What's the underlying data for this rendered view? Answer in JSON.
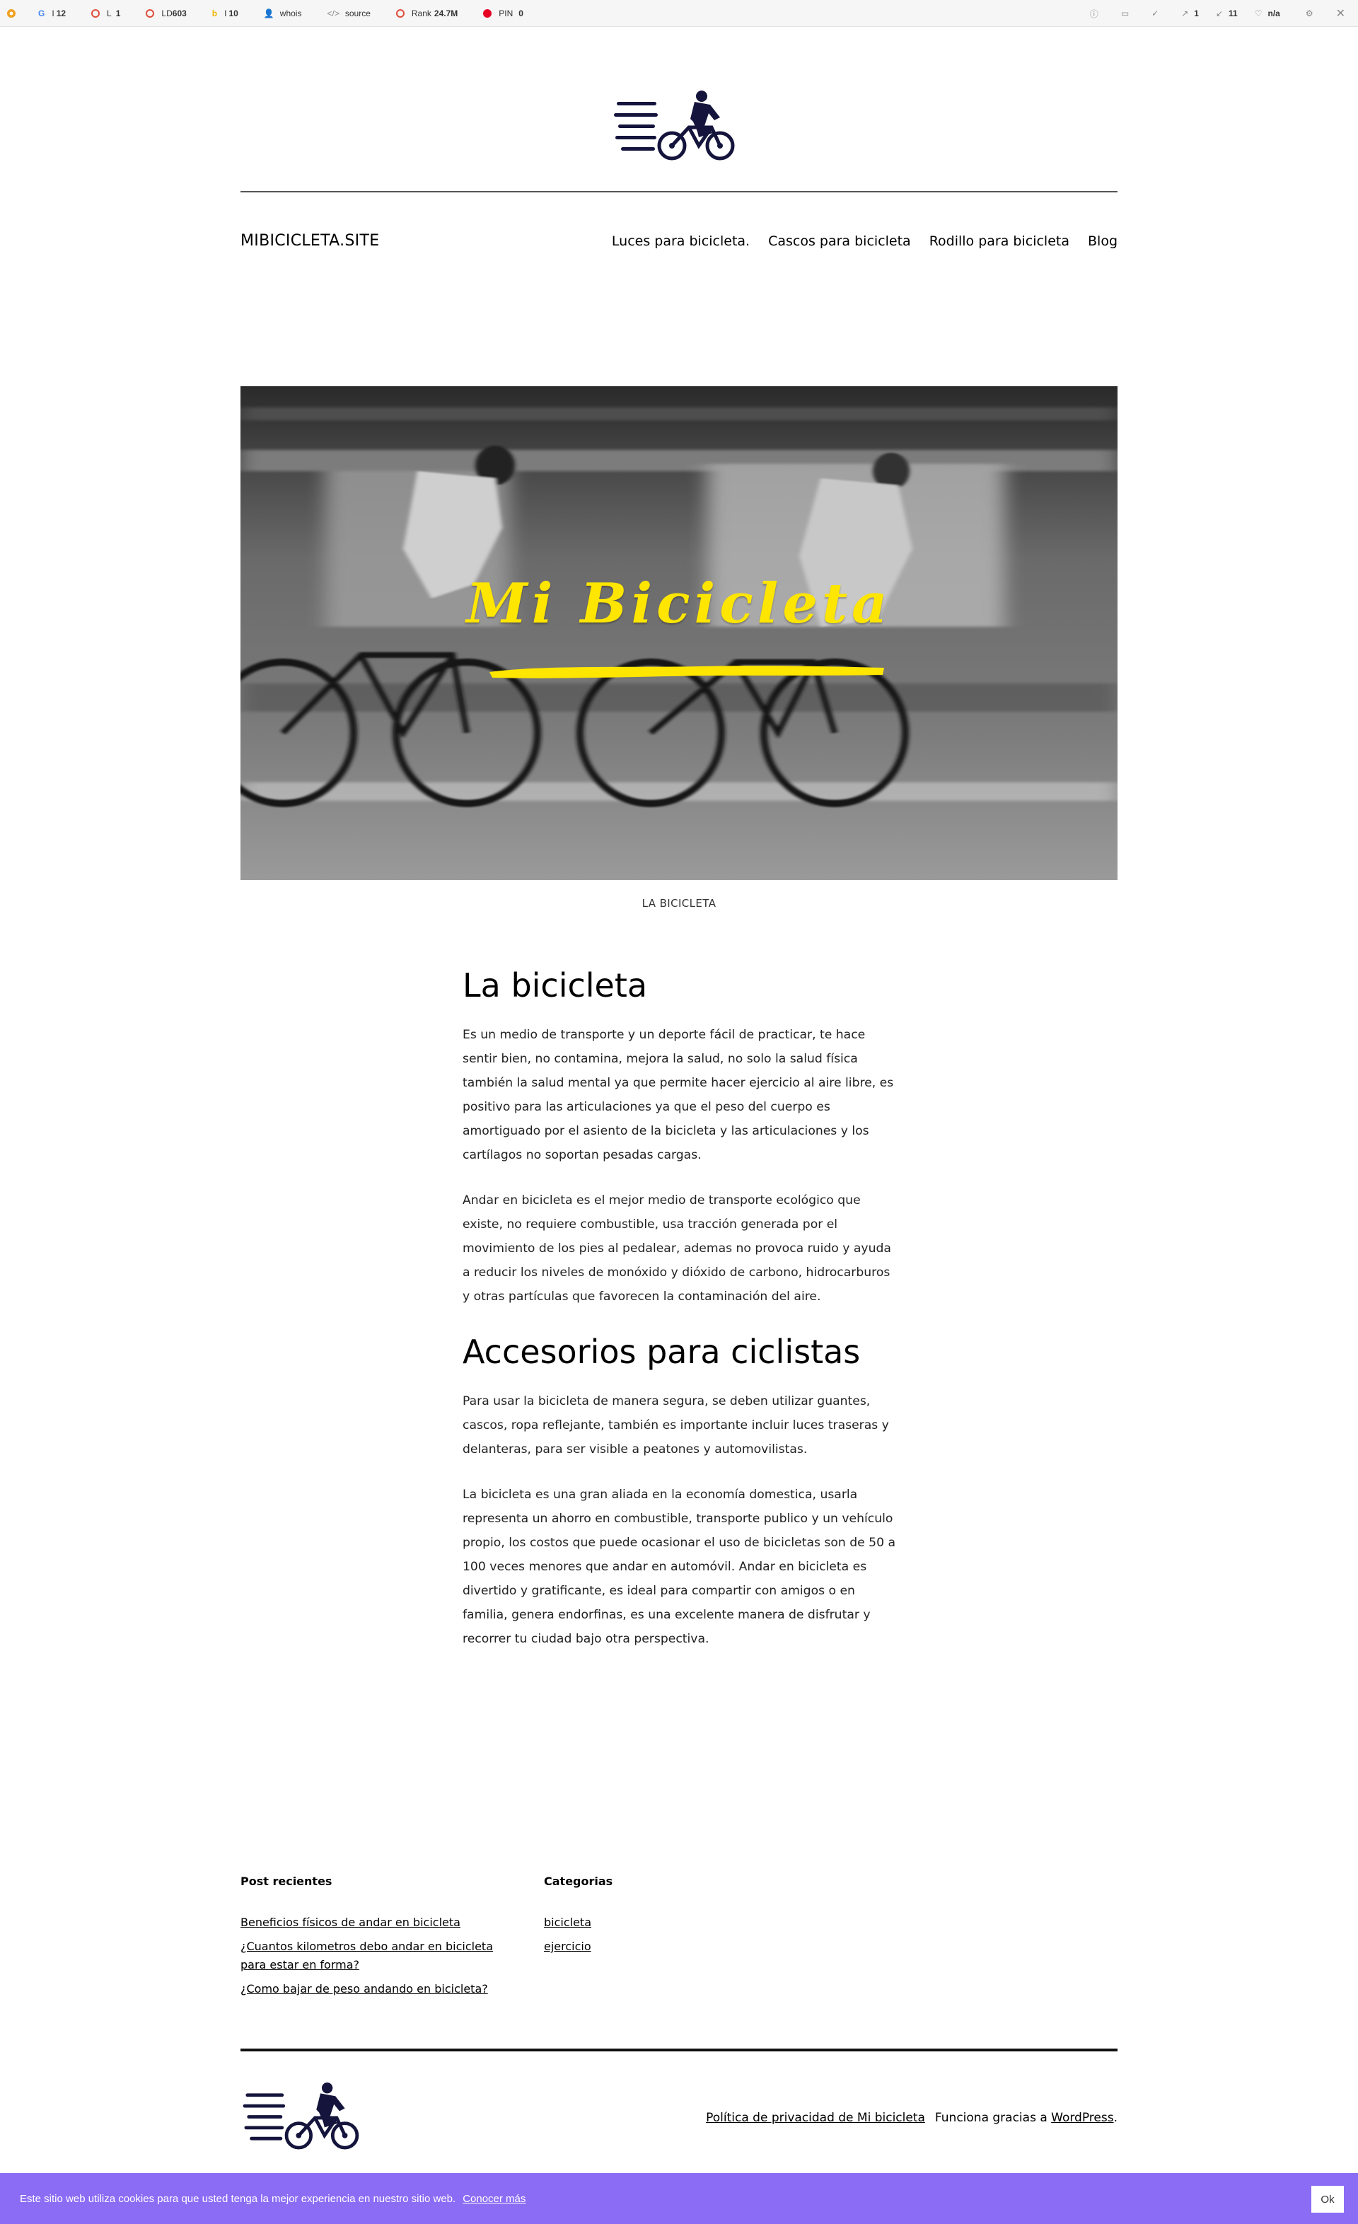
{
  "toolbar": {
    "items": [
      {
        "icon": "google-icon",
        "label": "I",
        "value": "12"
      },
      {
        "icon": "circle-icon",
        "label": "L",
        "value": "1"
      },
      {
        "icon": "circle-icon",
        "label": "LD",
        "value": "603"
      },
      {
        "icon": "bing-icon",
        "label": "I",
        "value": "10"
      },
      {
        "icon": "user-icon",
        "label": "whois",
        "value": ""
      },
      {
        "icon": "code-icon",
        "label": "source",
        "value": ""
      },
      {
        "icon": "circle-icon",
        "label": "Rank",
        "value": "24.7M"
      },
      {
        "icon": "pinterest-icon",
        "label": "PIN",
        "value": "0"
      }
    ],
    "right_items": [
      {
        "icon": "info-icon",
        "value": ""
      },
      {
        "icon": "monitor-icon",
        "value": ""
      },
      {
        "icon": "check-icon",
        "value": ""
      },
      {
        "icon": "external-link-icon",
        "value": "1"
      },
      {
        "icon": "internal-link-icon",
        "value": "11"
      },
      {
        "icon": "bookmark-icon",
        "value": "n/a"
      },
      {
        "icon": "gear-icon",
        "value": ""
      },
      {
        "icon": "close-icon",
        "value": ""
      }
    ]
  },
  "header": {
    "site_title": "MIBICICLETA.SITE",
    "nav": [
      "Luces para bicicleta.",
      "Cascos para bicicleta",
      "Rodillo para bicicleta",
      "Blog"
    ]
  },
  "hero": {
    "title": "Mi Bicicleta",
    "caption": "LA BICICLETA"
  },
  "article": {
    "h1": "La bicicleta",
    "p1": "Es un medio de transporte y un deporte fácil de practicar, te hace sentir bien, no contamina, mejora la salud, no solo la salud física también la salud mental ya que permite hacer ejercicio al aire libre, es positivo para las articulaciones ya que el peso del cuerpo es amortiguado por el asiento de la bicicleta y las articulaciones y los cartílagos no soportan pesadas cargas.",
    "p2": "Andar en bicicleta es el mejor medio de transporte ecológico que existe, no requiere combustible, usa tracción generada por el movimiento de los pies al pedalear, ademas no provoca ruido y ayuda a reducir los niveles de monóxido y dióxido de carbono, hidrocarburos y otras partículas que favorecen la contaminación del aire.",
    "h2": "Accesorios para ciclistas",
    "p3": "Para usar la bicicleta de manera segura, se deben utilizar guantes, cascos, ropa reflejante, también es importante incluir luces traseras y delanteras, para ser visible a peatones y automovilistas.",
    "p4": "La bicicleta es una gran aliada en la economía domestica, usarla representa un ahorro en combustible, transporte publico y un vehículo propio, los costos que puede ocasionar el uso de bicicletas son de 50 a 100 veces menores que andar en automóvil. Andar en bicicleta es divertido y gratificante, es ideal para compartir con amigos o en familia, genera endorfinas, es una excelente manera de disfrutar y recorrer tu ciudad bajo otra perspectiva."
  },
  "widgets": {
    "recent_title": "Post recientes",
    "recent": [
      "Beneficios físicos de andar en bicicleta",
      "¿Cuantos kilometros debo andar en bicicleta para estar en forma?",
      "¿Como bajar de peso andando en bicicleta?"
    ],
    "cat_title": "Categorias",
    "categories": [
      "bicicleta",
      "ejercicio"
    ]
  },
  "footer": {
    "privacy": "Política de privacidad de Mi bicicleta",
    "powered_prefix": "Funciona gracias a ",
    "powered_link": "WordPress",
    "powered_suffix": "."
  },
  "cookie": {
    "message": "Este sitio web utiliza cookies para que usted tenga la mejor experiencia en nuestro sitio web.",
    "more": "Conocer más",
    "ok": "Ok"
  },
  "colors": {
    "accent_yellow": "#ffe600",
    "cookie_bg": "#8b6cf4",
    "logo_navy": "#14143c"
  }
}
